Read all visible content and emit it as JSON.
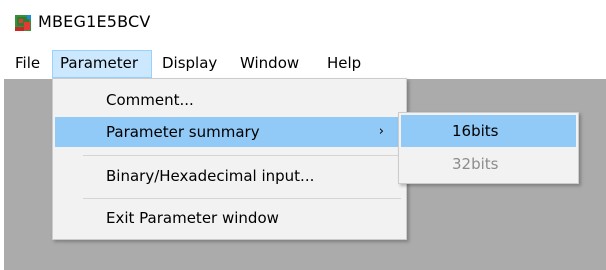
{
  "window": {
    "title": "MBEG1E5BCV",
    "icon": "app-icon"
  },
  "menubar": {
    "items": [
      {
        "label": "File"
      },
      {
        "label": "Parameter",
        "active": true
      },
      {
        "label": "Display"
      },
      {
        "label": "Window"
      },
      {
        "label": "Help"
      }
    ]
  },
  "parameter_menu": {
    "items": [
      {
        "label": "Comment..."
      },
      {
        "label": "Parameter summary",
        "submenu_arrow": "›",
        "highlighted": true
      },
      {
        "label": "Binary/Hexadecimal input..."
      },
      {
        "label": "Exit Parameter window"
      }
    ]
  },
  "summary_submenu": {
    "items": [
      {
        "label": "16bits",
        "highlighted": true,
        "enabled": true
      },
      {
        "label": "32bits",
        "enabled": false
      }
    ]
  },
  "colors": {
    "menu_highlight": "#91c9f7",
    "menubar_active": "#cce8ff",
    "client_background": "#ababab",
    "disabled_text": "#8c8c8c"
  }
}
